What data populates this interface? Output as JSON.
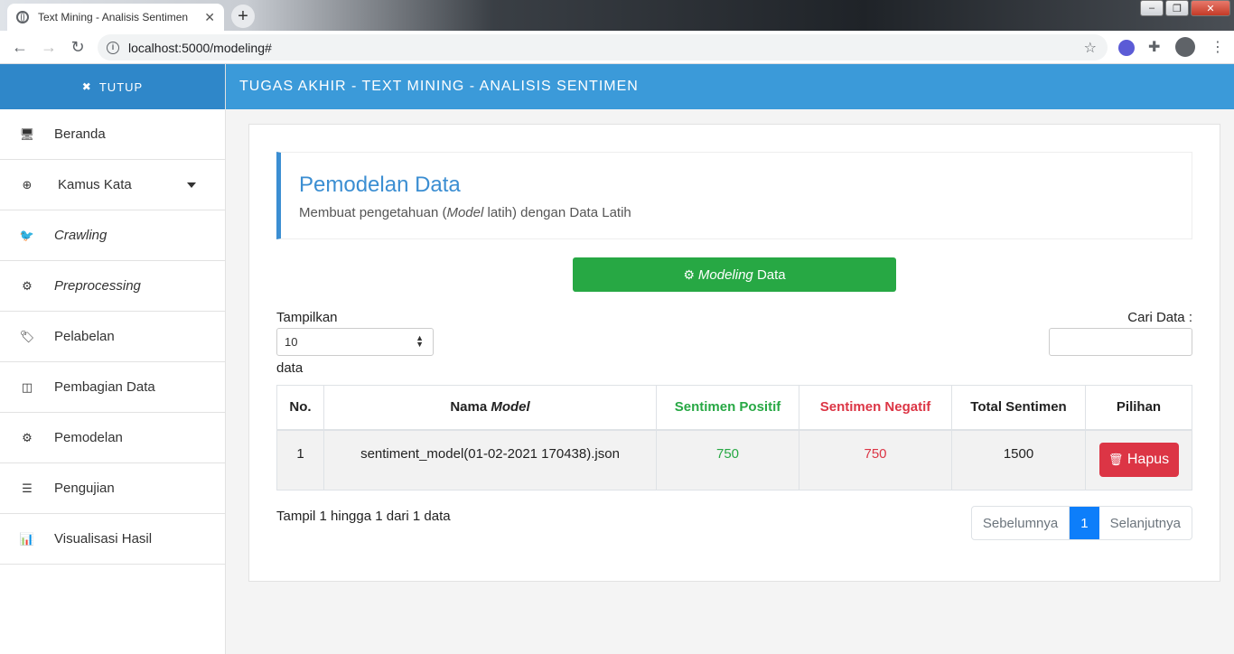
{
  "browser": {
    "tab_title": "Text Mining - Analisis Sentimen",
    "tab_close": "✕",
    "new_tab": "+",
    "url": "localhost:5000/modeling#",
    "back": "←",
    "forward": "→",
    "reload": "↻",
    "star": "☆",
    "minimize": "–",
    "maximize": "❐",
    "close": "✕"
  },
  "sidebar": {
    "close_icon": "✖",
    "close_label": "TUTUP",
    "items": [
      {
        "label": "Beranda",
        "icon": "🖥",
        "italic": false
      },
      {
        "label": "Kamus Kata",
        "icon": "⊕",
        "italic": false
      },
      {
        "label": "Crawling",
        "icon": "🐦",
        "italic": true
      },
      {
        "label": "Preprocessing",
        "icon": "⚙",
        "italic": true
      },
      {
        "label": "Pelabelan",
        "icon": "🏷",
        "italic": false
      },
      {
        "label": "Pembagian Data",
        "icon": "◫",
        "italic": false
      },
      {
        "label": "Pemodelan",
        "icon": "⚙",
        "italic": false
      },
      {
        "label": "Pengujian",
        "icon": "☰",
        "italic": false
      },
      {
        "label": "Visualisasi Hasil",
        "icon": "📊",
        "italic": false
      }
    ]
  },
  "topnav": {
    "title": "TUGAS AKHIR - TEXT MINING - ANALISIS SENTIMEN"
  },
  "page": {
    "heading": "Pemodelan Data",
    "subtitle_pre": "Membuat pengetahuan (",
    "subtitle_italic": "Model",
    "subtitle_post": " latih) dengan Data Latih",
    "model_btn_icon": "⚙",
    "model_btn_italic": "Modeling",
    "model_btn_rest": " Data"
  },
  "table_controls": {
    "length_label": "Tampilkan",
    "length_value": "10",
    "length_after": "data",
    "search_label": "Cari Data :"
  },
  "table": {
    "headers": {
      "no": "No.",
      "name_pre": "Nama ",
      "name_italic": "Model",
      "pos": "Sentimen Positif",
      "neg": "Sentimen Negatif",
      "total": "Total Sentimen",
      "action": "Pilihan"
    },
    "rows": [
      {
        "no": "1",
        "name": "sentiment_model(01-02-2021 170438).json",
        "pos": "750",
        "neg": "750",
        "total": "1500",
        "action": "Hapus",
        "action_icon": "🗑"
      }
    ]
  },
  "footer": {
    "info": "Tampil 1 hingga 1 dari 1 data",
    "prev": "Sebelumnya",
    "page": "1",
    "next": "Selanjutnya"
  },
  "colors": {
    "sidebar_header": "#2f87c9",
    "topnav": "#3b9ad9",
    "accent": "#3b8ed2",
    "success": "#27a844",
    "danger": "#dc3545",
    "pager_active": "#0d7efa"
  }
}
